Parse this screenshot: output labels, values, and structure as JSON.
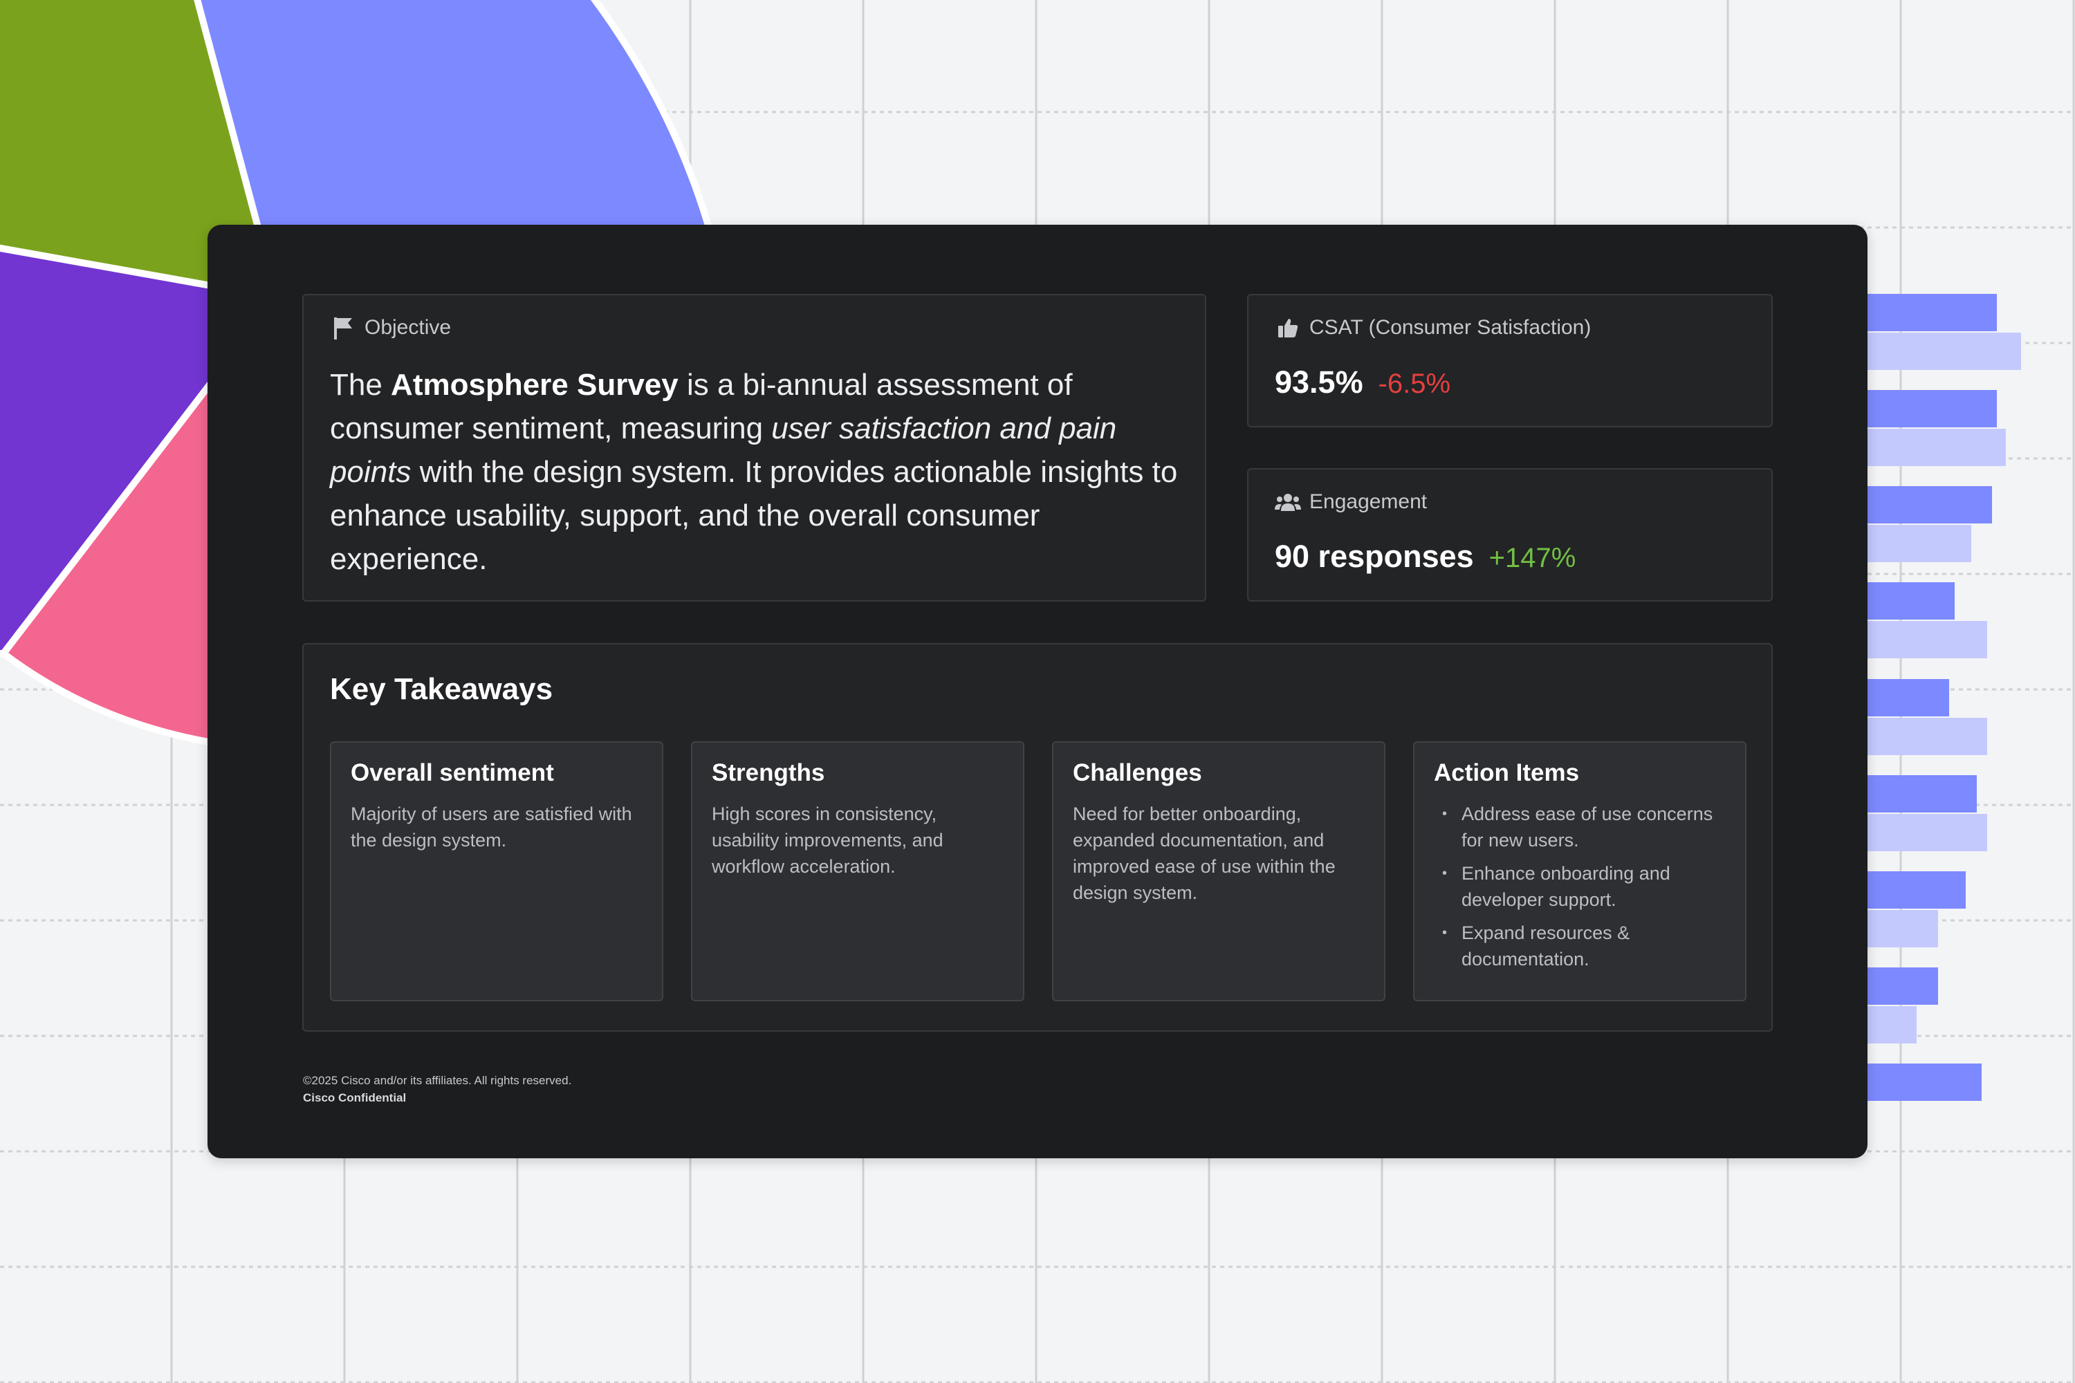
{
  "background": {
    "colors": {
      "green": "#7ba21d",
      "blue": "#7d89ff",
      "purple": "#7235d2",
      "pink": "#f3668f",
      "bar_dark": "#7d89ff",
      "bar_light": "#c4c9fd",
      "grid": "#d0d1d4"
    }
  },
  "objective": {
    "label": "Objective",
    "icon": "flag-icon",
    "text_prefix": "The ",
    "survey_name": "Atmosphere Survey",
    "text_middle": " is a bi-annual assessment of consumer sentiment, measuring ",
    "text_emphasis": "user satisfaction and pain points",
    "text_suffix": " with the design system. It provides actionable insights to enhance usability, support, and the overall consumer experience."
  },
  "csat": {
    "label": "CSAT (Consumer Satisfaction)",
    "icon": "thumbs-up-icon",
    "value": "93.5%",
    "delta": "-6.5%",
    "delta_color": "#e5403f"
  },
  "engagement": {
    "label": "Engagement",
    "icon": "users-icon",
    "value": "90 responses",
    "delta": "+147%",
    "delta_color": "#72c043"
  },
  "key_takeaways": {
    "title": "Key Takeaways",
    "cards": [
      {
        "title": "Overall sentiment",
        "body": "Majority of users are satisfied with the design system."
      },
      {
        "title": "Strengths",
        "body": "High scores in consistency, usability improvements, and workflow acceleration."
      },
      {
        "title": "Challenges",
        "body": "Need for better onboarding, expanded documentation, and improved ease of use within the design system."
      },
      {
        "title": "Action Items",
        "items": [
          "Address ease of use concerns for new users.",
          "Enhance onboarding and developer support.",
          "Expand resources & documentation."
        ]
      }
    ]
  },
  "footer": {
    "copyright": "©2025  Cisco and/or its affiliates. All rights reserved.",
    "confidential": "Cisco Confidential"
  }
}
